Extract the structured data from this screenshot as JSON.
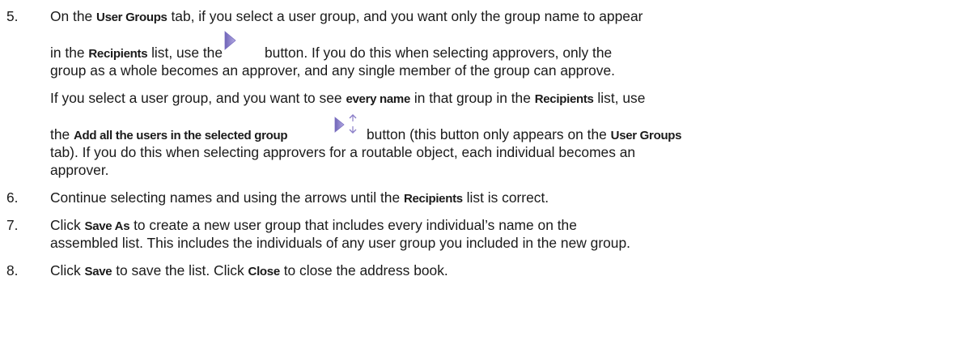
{
  "steps": [
    {
      "number": "5.",
      "para1": {
        "l1_a": "On the ",
        "l1_b": "User Groups",
        "l1_c": " tab, if you select a user group, and you want only the group name to appear",
        "l2_a": "in the ",
        "l2_b": "Recipients",
        "l2_c": " list, use the",
        "l2_d": "button. If you do this when selecting approvers, only the",
        "l3": "group as a whole becomes an approver, and any single member of the group can approve."
      },
      "para2": {
        "l1_a": "If you select a user group, and you want to see ",
        "l1_b": "every name",
        "l1_c": " in that group in the ",
        "l1_d": "Recipients",
        "l1_e": " list, use",
        "l2_a": "the ",
        "l2_b": "Add all the users in the selected group",
        "l2_c": "button (this button only appears on the ",
        "l2_d": "User Groups",
        "l3": "tab). If you do this when selecting approvers for a routable object, each individual becomes an",
        "l4": "approver."
      },
      "icons": {
        "add_selected": "add-arrow-icon",
        "add_all_users": "add-all-users-icon",
        "arrow_color": "#8b7fc8"
      }
    },
    {
      "number": "6.",
      "l1_a": "Continue selecting names and using the arrows until the ",
      "l1_b": "Recipients",
      "l1_c": " list is correct."
    },
    {
      "number": "7.",
      "l1_a": "Click ",
      "l1_b": "Save As",
      "l1_c": " to create a new user group that includes every individual’s name on the",
      "l2": "assembled list. This includes the individuals of any user group you included in the new group."
    },
    {
      "number": "8.",
      "l1_a": "Click ",
      "l1_b": "Save",
      "l1_c": " to save the list. Click ",
      "l1_d": "Close",
      "l1_e": " to close the address book."
    }
  ]
}
